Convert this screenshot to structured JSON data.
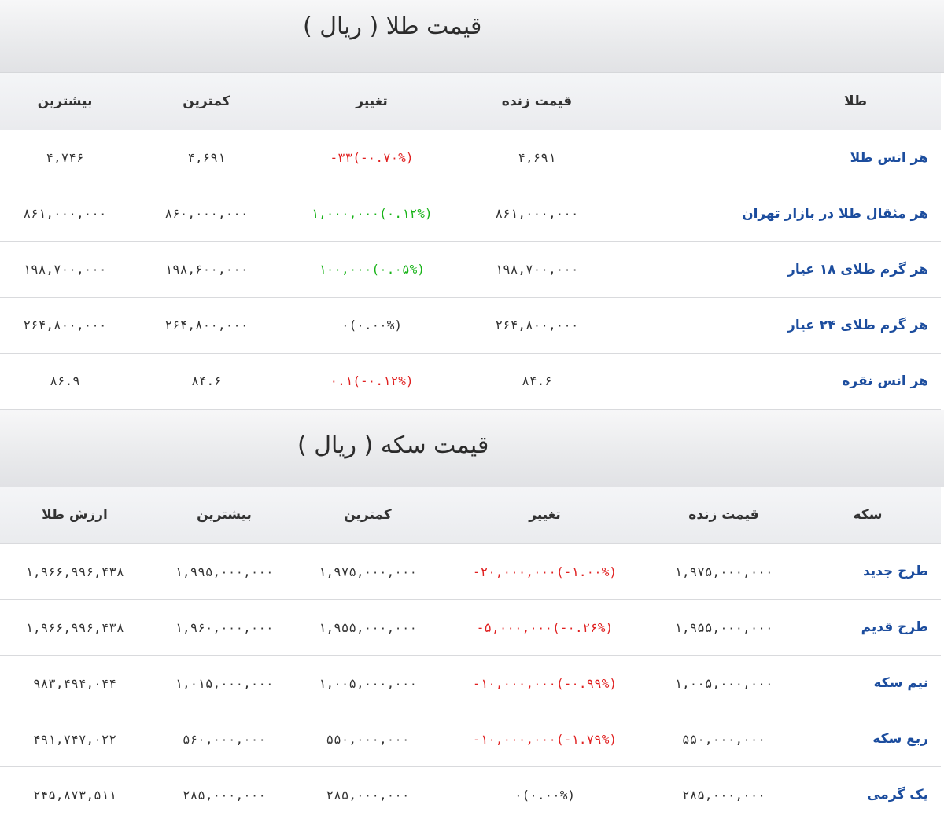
{
  "gold": {
    "title": "قیمت طلا ( ریال )",
    "headers": {
      "name": "طلا",
      "live": "قیمت زنده",
      "change": "تغییر",
      "low": "کمترین",
      "high": "بیشترین"
    },
    "rows": [
      {
        "name": "هر انس طلا",
        "live": "۴,۶۹۱",
        "change": "-۳۳(-۰.۷۰%)",
        "change_dir": "neg",
        "low": "۴,۶۹۱",
        "high": "۴,۷۴۶"
      },
      {
        "name": "هر مثقال طلا در بازار تهران",
        "live": "۸۶۱,۰۰۰,۰۰۰",
        "change": "۱,۰۰۰,۰۰۰(۰.۱۲%)",
        "change_dir": "pos",
        "low": "۸۶۰,۰۰۰,۰۰۰",
        "high": "۸۶۱,۰۰۰,۰۰۰"
      },
      {
        "name": "هر گرم طلای ۱۸ عیار",
        "live": "۱۹۸,۷۰۰,۰۰۰",
        "change": "۱۰۰,۰۰۰(۰.۰۵%)",
        "change_dir": "pos",
        "low": "۱۹۸,۶۰۰,۰۰۰",
        "high": "۱۹۸,۷۰۰,۰۰۰"
      },
      {
        "name": "هر گرم طلای ۲۴ عیار",
        "live": "۲۶۴,۸۰۰,۰۰۰",
        "change": "۰(۰.۰۰%)",
        "change_dir": "zero",
        "low": "۲۶۴,۸۰۰,۰۰۰",
        "high": "۲۶۴,۸۰۰,۰۰۰"
      },
      {
        "name": "هر انس نقره",
        "live": "۸۴.۶",
        "change": "۰.۱(-۰.۱۲%)",
        "change_dir": "neg",
        "low": "۸۴.۶",
        "high": "۸۶.۹"
      }
    ]
  },
  "coin": {
    "title": "قیمت سکه ( ریال )",
    "headers": {
      "name": "سکه",
      "live": "قیمت زنده",
      "change": "تغییر",
      "low": "کمترین",
      "high": "بیشترین",
      "value": "ارزش طلا"
    },
    "rows": [
      {
        "name": "طرح جدید",
        "live": "۱,۹۷۵,۰۰۰,۰۰۰",
        "change": "-۲۰,۰۰۰,۰۰۰(-۱.۰۰%)",
        "change_dir": "neg",
        "low": "۱,۹۷۵,۰۰۰,۰۰۰",
        "high": "۱,۹۹۵,۰۰۰,۰۰۰",
        "value": "۱,۹۶۶,۹۹۶,۴۳۸"
      },
      {
        "name": "طرح قدیم",
        "live": "۱,۹۵۵,۰۰۰,۰۰۰",
        "change": "-۵,۰۰۰,۰۰۰(-۰.۲۶%)",
        "change_dir": "neg",
        "low": "۱,۹۵۵,۰۰۰,۰۰۰",
        "high": "۱,۹۶۰,۰۰۰,۰۰۰",
        "value": "۱,۹۶۶,۹۹۶,۴۳۸"
      },
      {
        "name": "نیم سکه",
        "live": "۱,۰۰۵,۰۰۰,۰۰۰",
        "change": "-۱۰,۰۰۰,۰۰۰(-۰.۹۹%)",
        "change_dir": "neg",
        "low": "۱,۰۰۵,۰۰۰,۰۰۰",
        "high": "۱,۰۱۵,۰۰۰,۰۰۰",
        "value": "۹۸۳,۴۹۴,۰۴۴"
      },
      {
        "name": "ربع سکه",
        "live": "۵۵۰,۰۰۰,۰۰۰",
        "change": "-۱۰,۰۰۰,۰۰۰(-۱.۷۹%)",
        "change_dir": "neg",
        "low": "۵۵۰,۰۰۰,۰۰۰",
        "high": "۵۶۰,۰۰۰,۰۰۰",
        "value": "۴۹۱,۷۴۷,۰۲۲"
      },
      {
        "name": "یک گرمی",
        "live": "۲۸۵,۰۰۰,۰۰۰",
        "change": "۰(۰.۰۰%)",
        "change_dir": "zero",
        "low": "۲۸۵,۰۰۰,۰۰۰",
        "high": "۲۸۵,۰۰۰,۰۰۰",
        "value": "۲۴۵,۸۷۳,۵۱۱"
      }
    ]
  },
  "colors": {
    "positive": "#17b317",
    "negative": "#e02020",
    "name_link": "#1c4d9e"
  }
}
